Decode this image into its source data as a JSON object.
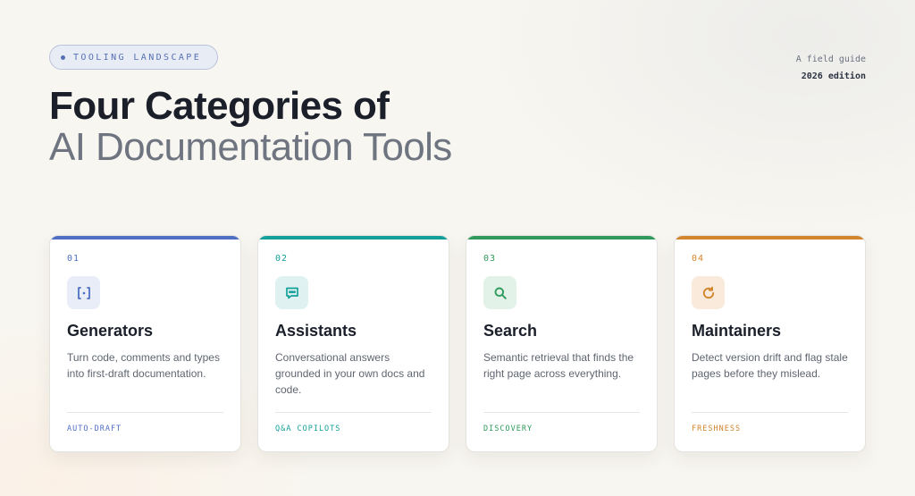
{
  "header": {
    "badge_label": "TOOLING LANDSCAPE",
    "guide_label": "A field guide",
    "edition_label": "2026 edition",
    "title_line1": "Four Categories of",
    "title_line2": "AI Documentation Tools"
  },
  "cards": [
    {
      "number": "01",
      "icon": "brackets-dot-icon",
      "title": "Generators",
      "description": "Turn code, comments and types into first-draft documentation.",
      "tag": "AUTO-DRAFT",
      "accent": "#4f6fc4",
      "icon_bg": "#e8edf8"
    },
    {
      "number": "02",
      "icon": "chat-bubble-icon",
      "title": "Assistants",
      "description": "Conversational answers grounded in your own docs and code.",
      "tag": "Q&A COPILOTS",
      "accent": "#14a09a",
      "icon_bg": "#dff2f1"
    },
    {
      "number": "03",
      "icon": "magnifier-icon",
      "title": "Search",
      "description": "Semantic retrieval that finds the right page across everything.",
      "tag": "DISCOVERY",
      "accent": "#2f9a5c",
      "icon_bg": "#e2f2e8"
    },
    {
      "number": "04",
      "icon": "refresh-icon",
      "title": "Maintainers",
      "description": "Detect version drift and flag stale pages before they mislead.",
      "tag": "FRESHNESS",
      "accent": "#d2852c",
      "icon_bg": "#faeadb"
    }
  ]
}
